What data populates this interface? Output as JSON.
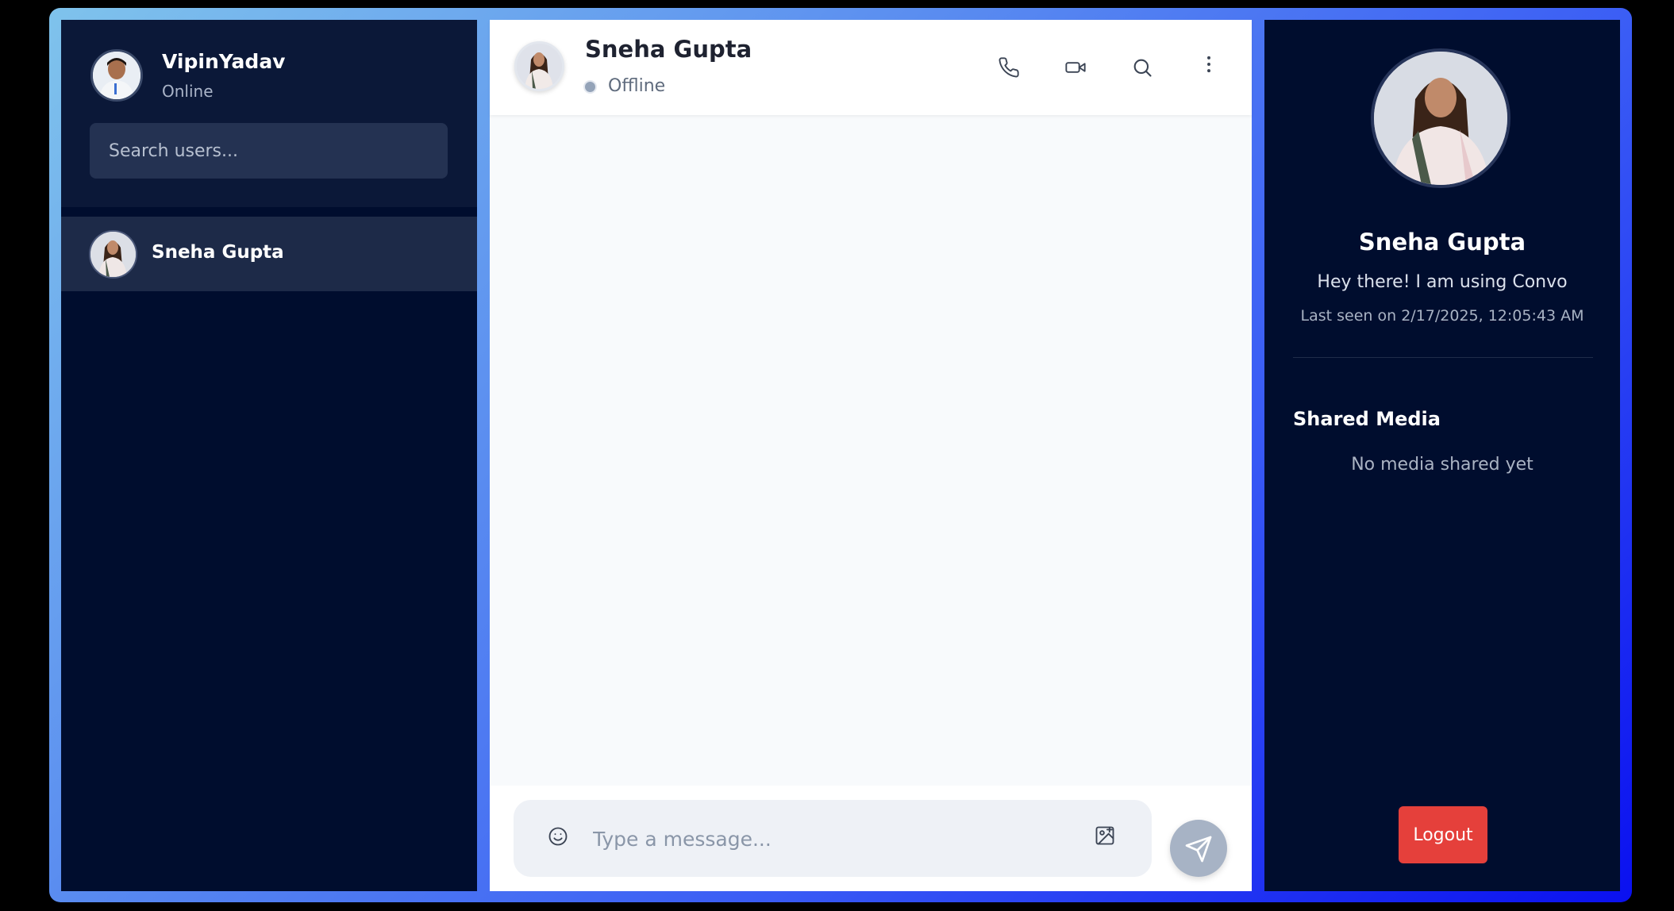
{
  "current_user": {
    "name": "VipinYadav",
    "status": "Online"
  },
  "search": {
    "placeholder": "Search users..."
  },
  "contacts": [
    {
      "name": "Sneha Gupta"
    }
  ],
  "chat": {
    "contact_name": "Sneha Gupta",
    "contact_status": "Offline",
    "header_icons": [
      "phone-icon",
      "video-icon",
      "search-icon",
      "more-vertical-icon"
    ],
    "message_placeholder": "Type a message..."
  },
  "profile": {
    "name": "Sneha Gupta",
    "bio": "Hey there! I am using Convo",
    "last_seen": "Last seen on 2/17/2025, 12:05:43 AM",
    "shared_media_title": "Shared Media",
    "shared_media_empty": "No media shared yet",
    "logout_label": "Logout"
  },
  "colors": {
    "sidebar_bg": "#000d2e",
    "selected_contact_bg": "#1d2a48",
    "logout_bg": "#e5403b",
    "send_button_bg": "#a7b3c5",
    "offline_dot": "#94a3b8"
  }
}
